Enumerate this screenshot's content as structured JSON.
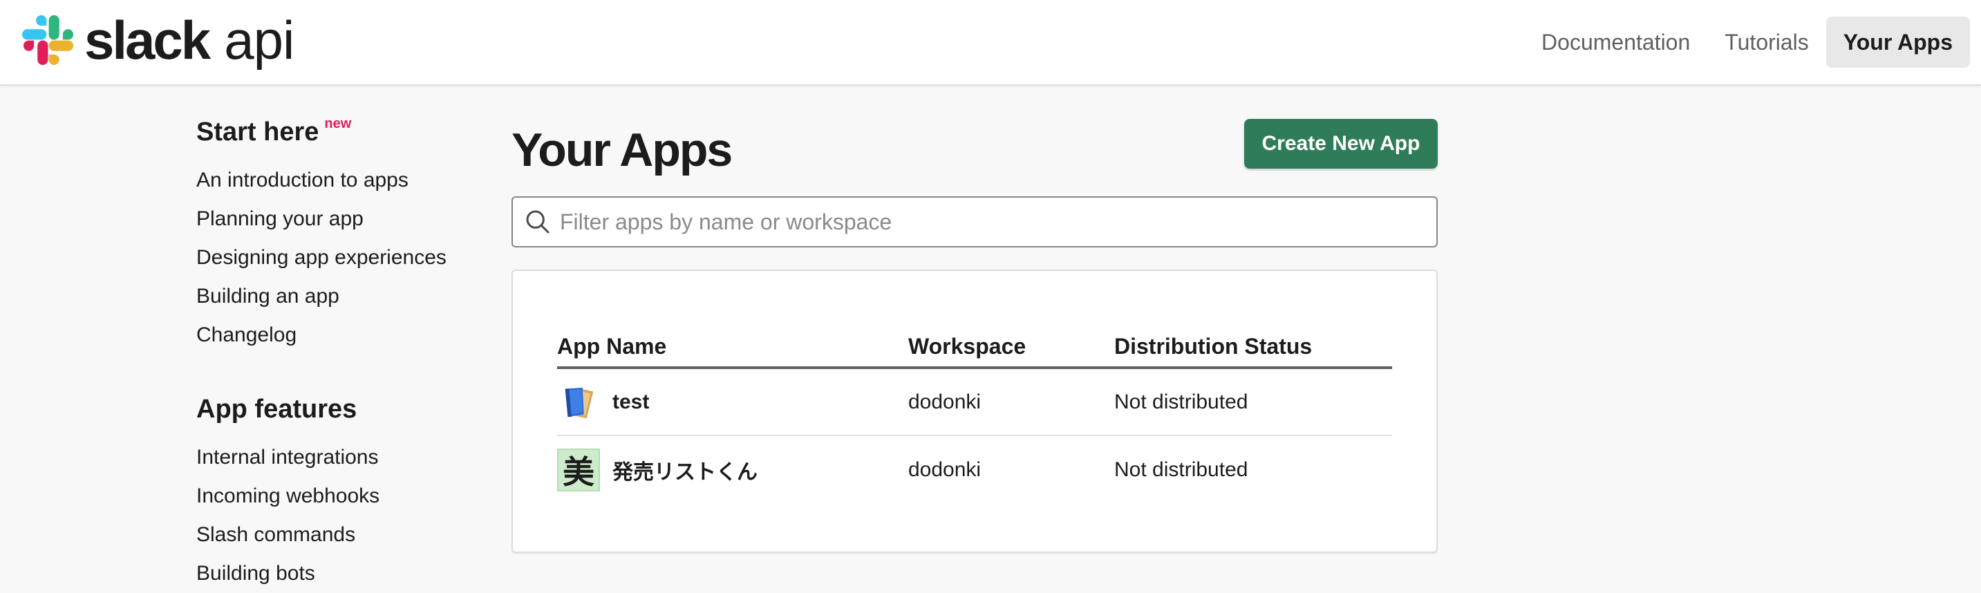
{
  "header": {
    "logo_word": "slack",
    "logo_suffix": "api",
    "nav": [
      {
        "label": "Documentation"
      },
      {
        "label": "Tutorials"
      },
      {
        "label": "Your Apps",
        "active": true
      }
    ]
  },
  "sidebar": {
    "sections": [
      {
        "title": "Start here",
        "badge": "new",
        "links": [
          "An introduction to apps",
          "Planning your app",
          "Designing app experiences",
          "Building an app",
          "Changelog"
        ]
      },
      {
        "title": "App features",
        "links": [
          "Internal integrations",
          "Incoming webhooks",
          "Slash commands",
          "Building bots"
        ]
      }
    ]
  },
  "main": {
    "title": "Your Apps",
    "create_button": "Create New App",
    "search_placeholder": "Filter apps by name or workspace",
    "table": {
      "columns": [
        "App Name",
        "Workspace",
        "Distribution Status"
      ],
      "rows": [
        {
          "name": "test",
          "icon": "book-icon",
          "workspace": "dodonki",
          "status": "Not distributed"
        },
        {
          "name": "発売リストくん",
          "icon_glyph": "美",
          "workspace": "dodonki",
          "status": "Not distributed"
        }
      ]
    }
  },
  "colors": {
    "brand_button": "#2e7d58",
    "new_badge": "#e01e5a",
    "page_background": "#f8f8f8"
  }
}
